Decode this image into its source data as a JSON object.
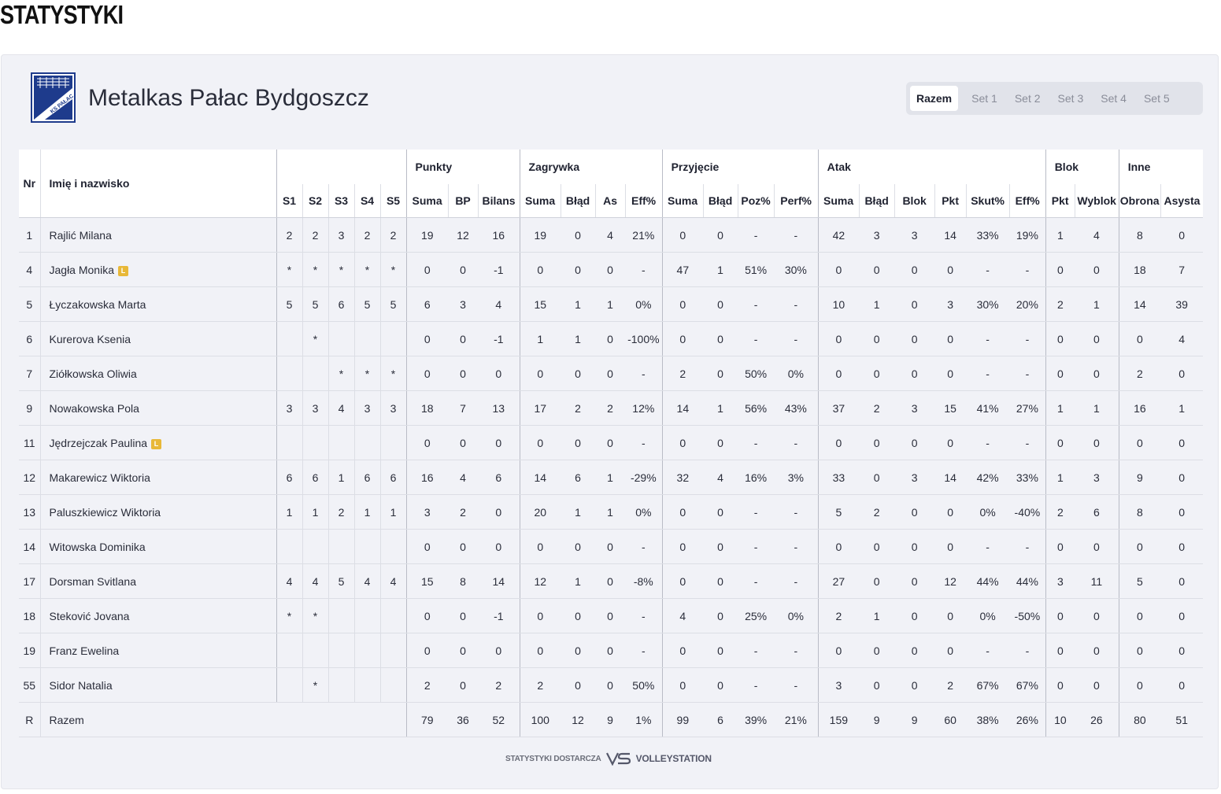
{
  "page": {
    "title": "STATYSTYKI"
  },
  "team": {
    "name": "Metalkas Pałac Bydgoszcz",
    "logo_text": "KS PAŁAC"
  },
  "tabs": [
    "Razem",
    "Set 1",
    "Set 2",
    "Set 3",
    "Set 4",
    "Set 5"
  ],
  "active_tab": "Razem",
  "table": {
    "nr_header": "Nr",
    "name_header": "Imię i nazwisko",
    "groups": [
      "Punkty",
      "Zagrywka",
      "Przyjęcie",
      "Atak",
      "Blok",
      "Inne"
    ],
    "columns": [
      "S1",
      "S2",
      "S3",
      "S4",
      "S5",
      "Suma",
      "BP",
      "Bilans",
      "Suma",
      "Błąd",
      "As",
      "Eff%",
      "Suma",
      "Błąd",
      "Poz%",
      "Perf%",
      "Suma",
      "Błąd",
      "Blok",
      "Pkt",
      "Skut%",
      "Eff%",
      "Pkt",
      "Wyblok",
      "Obrona",
      "Asysta"
    ],
    "liberos": [
      "Jagła Monika",
      "Jędrzejczak Paulina"
    ],
    "libero_badge": "L",
    "rows": [
      {
        "nr": "1",
        "name": "Rajlić Milana",
        "v": [
          "2",
          "2",
          "3",
          "2",
          "2",
          "19",
          "12",
          "16",
          "19",
          "0",
          "4",
          "21%",
          "0",
          "0",
          "-",
          "-",
          "42",
          "3",
          "3",
          "14",
          "33%",
          "19%",
          "1",
          "4",
          "8",
          "0"
        ]
      },
      {
        "nr": "4",
        "name": "Jagła Monika",
        "v": [
          "*",
          "*",
          "*",
          "*",
          "*",
          "0",
          "0",
          "-1",
          "0",
          "0",
          "0",
          "-",
          "47",
          "1",
          "51%",
          "30%",
          "0",
          "0",
          "0",
          "0",
          "-",
          "-",
          "0",
          "0",
          "18",
          "7"
        ]
      },
      {
        "nr": "5",
        "name": "Łyczakowska Marta",
        "v": [
          "5",
          "5",
          "6",
          "5",
          "5",
          "6",
          "3",
          "4",
          "15",
          "1",
          "1",
          "0%",
          "0",
          "0",
          "-",
          "-",
          "10",
          "1",
          "0",
          "3",
          "30%",
          "20%",
          "2",
          "1",
          "14",
          "39"
        ]
      },
      {
        "nr": "6",
        "name": "Kurerova Ksenia",
        "v": [
          "",
          "*",
          "",
          "",
          "",
          "0",
          "0",
          "-1",
          "1",
          "1",
          "0",
          "-100%",
          "0",
          "0",
          "-",
          "-",
          "0",
          "0",
          "0",
          "0",
          "-",
          "-",
          "0",
          "0",
          "0",
          "4"
        ]
      },
      {
        "nr": "7",
        "name": "Ziółkowska Oliwia",
        "v": [
          "",
          "",
          "*",
          "*",
          "*",
          "0",
          "0",
          "0",
          "0",
          "0",
          "0",
          "-",
          "2",
          "0",
          "50%",
          "0%",
          "0",
          "0",
          "0",
          "0",
          "-",
          "-",
          "0",
          "0",
          "2",
          "0"
        ]
      },
      {
        "nr": "9",
        "name": "Nowakowska Pola",
        "v": [
          "3",
          "3",
          "4",
          "3",
          "3",
          "18",
          "7",
          "13",
          "17",
          "2",
          "2",
          "12%",
          "14",
          "1",
          "56%",
          "43%",
          "37",
          "2",
          "3",
          "15",
          "41%",
          "27%",
          "1",
          "1",
          "16",
          "1"
        ]
      },
      {
        "nr": "11",
        "name": "Jędrzejczak Paulina",
        "v": [
          "",
          "",
          "",
          "",
          "",
          "0",
          "0",
          "0",
          "0",
          "0",
          "0",
          "-",
          "0",
          "0",
          "-",
          "-",
          "0",
          "0",
          "0",
          "0",
          "-",
          "-",
          "0",
          "0",
          "0",
          "0"
        ]
      },
      {
        "nr": "12",
        "name": "Makarewicz Wiktoria",
        "v": [
          "6",
          "6",
          "1",
          "6",
          "6",
          "16",
          "4",
          "6",
          "14",
          "6",
          "1",
          "-29%",
          "32",
          "4",
          "16%",
          "3%",
          "33",
          "0",
          "3",
          "14",
          "42%",
          "33%",
          "1",
          "3",
          "9",
          "0"
        ]
      },
      {
        "nr": "13",
        "name": "Paluszkiewicz Wiktoria",
        "v": [
          "1",
          "1",
          "2",
          "1",
          "1",
          "3",
          "2",
          "0",
          "20",
          "1",
          "1",
          "0%",
          "0",
          "0",
          "-",
          "-",
          "5",
          "2",
          "0",
          "0",
          "0%",
          "-40%",
          "2",
          "6",
          "8",
          "0"
        ]
      },
      {
        "nr": "14",
        "name": "Witowska Dominika",
        "v": [
          "",
          "",
          "",
          "",
          "",
          "0",
          "0",
          "0",
          "0",
          "0",
          "0",
          "-",
          "0",
          "0",
          "-",
          "-",
          "0",
          "0",
          "0",
          "0",
          "-",
          "-",
          "0",
          "0",
          "0",
          "0"
        ]
      },
      {
        "nr": "17",
        "name": "Dorsman Svitlana",
        "v": [
          "4",
          "4",
          "5",
          "4",
          "4",
          "15",
          "8",
          "14",
          "12",
          "1",
          "0",
          "-8%",
          "0",
          "0",
          "-",
          "-",
          "27",
          "0",
          "0",
          "12",
          "44%",
          "44%",
          "3",
          "11",
          "5",
          "0"
        ]
      },
      {
        "nr": "18",
        "name": "Steković Jovana",
        "v": [
          "*",
          "*",
          "",
          "",
          "",
          "0",
          "0",
          "-1",
          "0",
          "0",
          "0",
          "-",
          "4",
          "0",
          "25%",
          "0%",
          "2",
          "1",
          "0",
          "0",
          "0%",
          "-50%",
          "0",
          "0",
          "0",
          "0"
        ]
      },
      {
        "nr": "19",
        "name": "Franz Ewelina",
        "v": [
          "",
          "",
          "",
          "",
          "",
          "0",
          "0",
          "0",
          "0",
          "0",
          "0",
          "-",
          "0",
          "0",
          "-",
          "-",
          "0",
          "0",
          "0",
          "0",
          "-",
          "-",
          "0",
          "0",
          "0",
          "0"
        ]
      },
      {
        "nr": "55",
        "name": "Sidor Natalia",
        "v": [
          "",
          "*",
          "",
          "",
          "",
          "2",
          "0",
          "2",
          "2",
          "0",
          "0",
          "50%",
          "0",
          "0",
          "-",
          "-",
          "3",
          "0",
          "0",
          "2",
          "67%",
          "67%",
          "0",
          "0",
          "0",
          "0"
        ]
      }
    ],
    "total": {
      "nr": "R",
      "name": "Razem",
      "v": [
        "79",
        "36",
        "52",
        "100",
        "12",
        "9",
        "1%",
        "99",
        "6",
        "39%",
        "21%",
        "159",
        "9",
        "9",
        "60",
        "38%",
        "26%",
        "10",
        "26",
        "80",
        "51"
      ]
    }
  },
  "footer": {
    "provider_label": "STATYSTYKI DOSTARCZA",
    "brand": "VOLLEYSTATION"
  }
}
